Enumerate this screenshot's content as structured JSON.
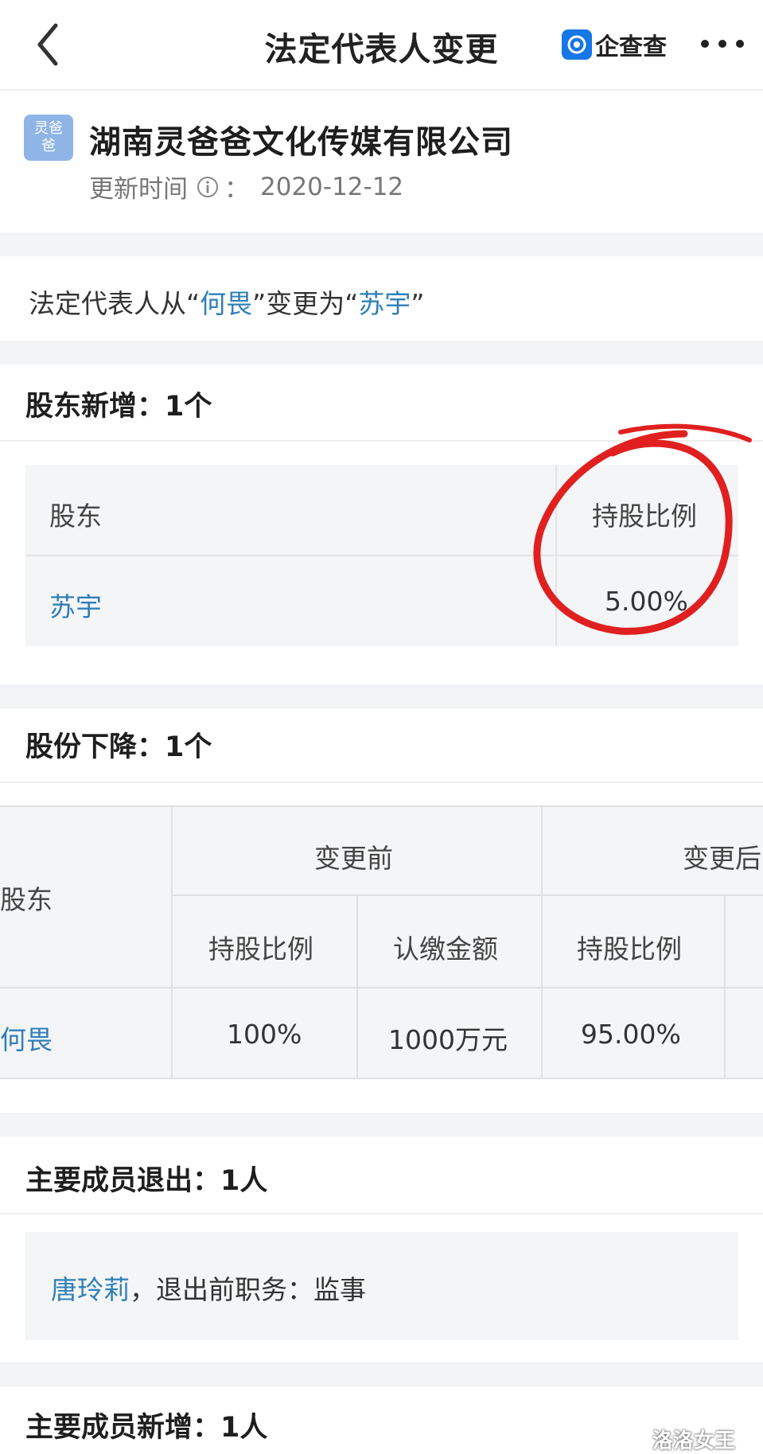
{
  "header": {
    "back_icon": "chevron-left-icon",
    "title": "法定代表人变更",
    "brand_name": "企查查",
    "more_icon": "more-dots-icon"
  },
  "company": {
    "logo_text_top": "灵爸",
    "logo_text_bottom": "爸",
    "name": "湖南灵爸爸文化传媒有限公司",
    "update_label": "更新时间",
    "update_sep": "：",
    "update_date": "2020-12-12"
  },
  "legal_rep_change": {
    "prefix": "法定代表人从“",
    "from": "何畏",
    "middle": "”变更为“",
    "to": "苏宇",
    "suffix": "”"
  },
  "new_shareholders": {
    "title": "股东新增：1个",
    "columns": [
      "股东",
      "持股比例"
    ],
    "rows": [
      {
        "name": "苏宇",
        "ratio": "5.00%"
      }
    ]
  },
  "share_decrease": {
    "title": "股份下降：1个",
    "col_shareholder": "股东",
    "group_before": "变更前",
    "group_after": "变更后",
    "sub_ratio_before": "持股比例",
    "sub_amount_before": "认缴金额",
    "sub_ratio_after": "持股比例",
    "row": {
      "name": "何畏",
      "ratio_before": "100%",
      "amount_before": "1000万元",
      "ratio_after": "95.00%"
    }
  },
  "member_exit": {
    "title": "主要成员退出：1人",
    "name": "唐玲莉",
    "detail": "，退出前职务：监事"
  },
  "member_add": {
    "title": "主要成员新增：1人"
  },
  "watermark": "洛洛女王",
  "colors": {
    "link": "#2f7fb8",
    "brand": "#1677e6",
    "annotation_circle": "#e02020"
  }
}
